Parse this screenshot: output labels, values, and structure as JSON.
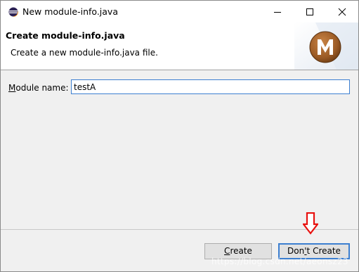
{
  "window": {
    "title": "New module-info.java"
  },
  "header": {
    "title": "Create module-info.java",
    "description": "Create a new module-info.java file."
  },
  "form": {
    "module_label_mnemonic": "M",
    "module_label_rest": "odule name:",
    "module_value": "testA"
  },
  "buttons": {
    "create_mnemonic": "C",
    "create_rest": "reate",
    "dont_prefix": "Don",
    "dont_mnemonic": "'",
    "dont_rest": "t Create"
  },
  "watermark": "https://blog.csdn.net/aeonsz23",
  "colors": {
    "accent": "#3c7fd0",
    "arrow": "#e8110f",
    "logo_brown": "#a0612a"
  },
  "icons": [
    "eclipse-icon",
    "minimize-icon",
    "maximize-icon",
    "close-icon",
    "maven-logo-icon",
    "red-down-arrow-icon"
  ]
}
